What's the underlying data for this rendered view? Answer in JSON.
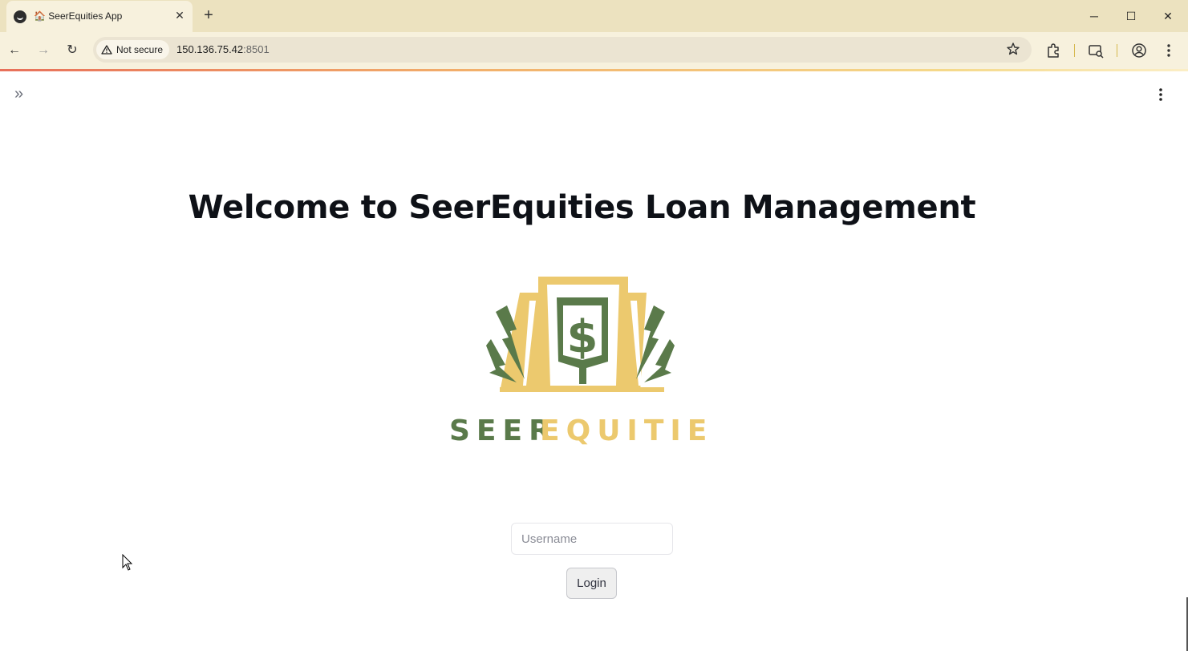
{
  "browser": {
    "tab_title": "🏠 SeerEquities App",
    "tab_close": "✕",
    "new_tab": "+",
    "security_label": "Not secure",
    "url_host": "150.136.75.42",
    "url_port": ":8501",
    "window_controls": {
      "minimize": "─",
      "maximize": "☐",
      "close": "✕"
    },
    "nav": {
      "back": "←",
      "forward": "→",
      "reload": "↻"
    }
  },
  "app": {
    "sidebar_toggle": "»",
    "title": "Welcome to SeerEquities Loan Management",
    "logo": {
      "word_left": "SEER",
      "word_right": "EQUITIES",
      "currency_symbol": "$",
      "color_green": "#5a7a4a",
      "color_gold": "#ecc96e"
    },
    "login": {
      "username_placeholder": "Username",
      "username_value": "",
      "button_label": "Login"
    }
  },
  "colors": {
    "tabstrip": "#ece2bf",
    "toolbar": "#f7f1dd",
    "title_text": "#0e1117"
  }
}
